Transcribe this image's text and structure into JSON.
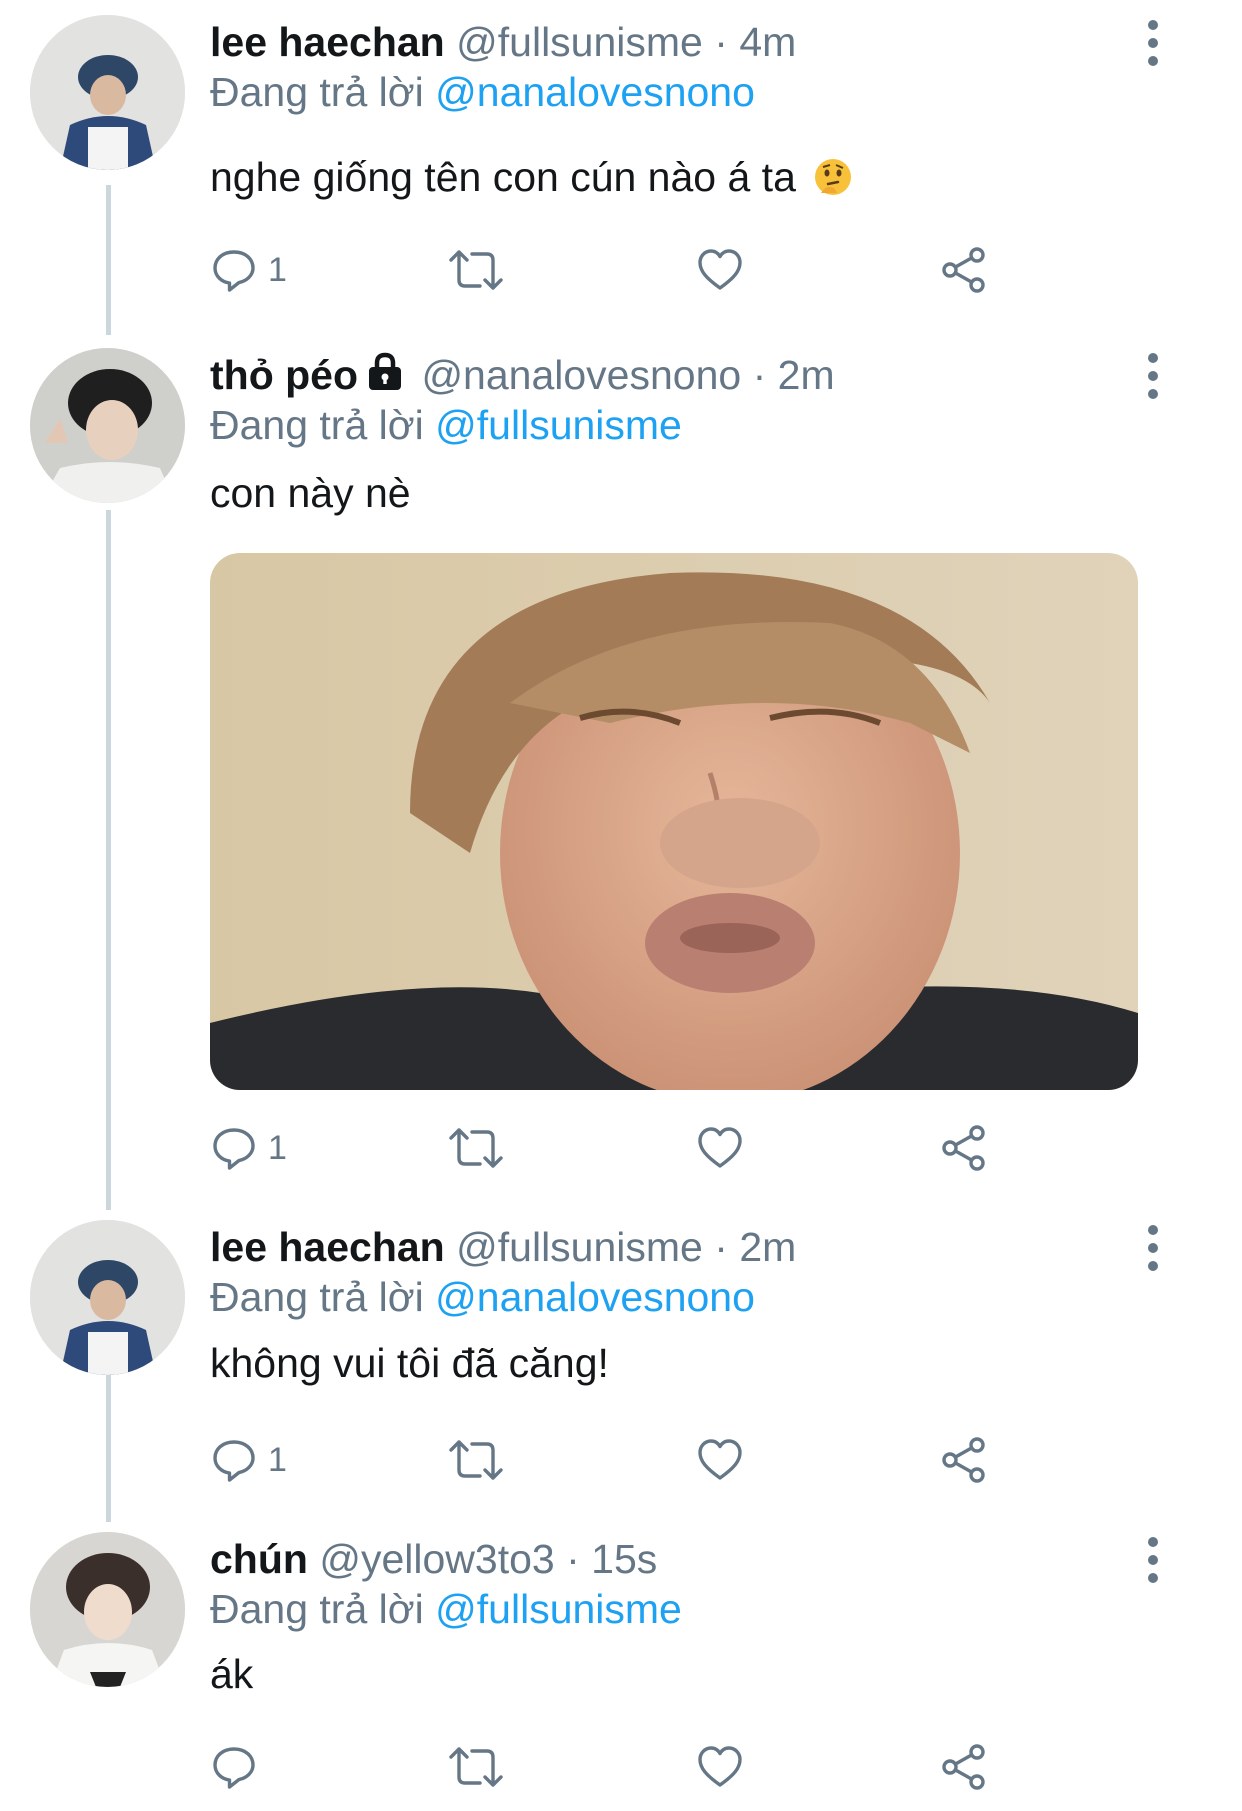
{
  "theme": {
    "accent": "#1da1f2",
    "secondary_text": "#657786",
    "line": "#ccd6dd"
  },
  "reply_prefix": "Đang trả lời",
  "tweets": [
    {
      "name": "lee haechan",
      "handle": "@fullsunisme",
      "time": "4m",
      "reply_to": "@nanalovesnono",
      "text": "nghe giống tên con cún nào á ta",
      "emoji": "thinking-face-emoji",
      "reply_count": "1",
      "locked": false
    },
    {
      "name": "thỏ péo",
      "handle": "@nanalovesnono",
      "time": "2m",
      "reply_to": "@fullsunisme",
      "text": "con này nè",
      "has_media": true,
      "reply_count": "1",
      "locked": true
    },
    {
      "name": "lee haechan",
      "handle": "@fullsunisme",
      "time": "2m",
      "reply_to": "@nanalovesnono",
      "text": "không vui tôi đã căng!",
      "reply_count": "1",
      "locked": false
    },
    {
      "name": "chún",
      "handle": "@yellow3to3",
      "time": "15s",
      "reply_to": "@fullsunisme",
      "text": "ák",
      "reply_count": "",
      "locked": false
    }
  ],
  "icons": [
    "reply-icon",
    "retweet-icon",
    "like-icon",
    "share-icon",
    "more-options-icon",
    "lock-icon"
  ]
}
